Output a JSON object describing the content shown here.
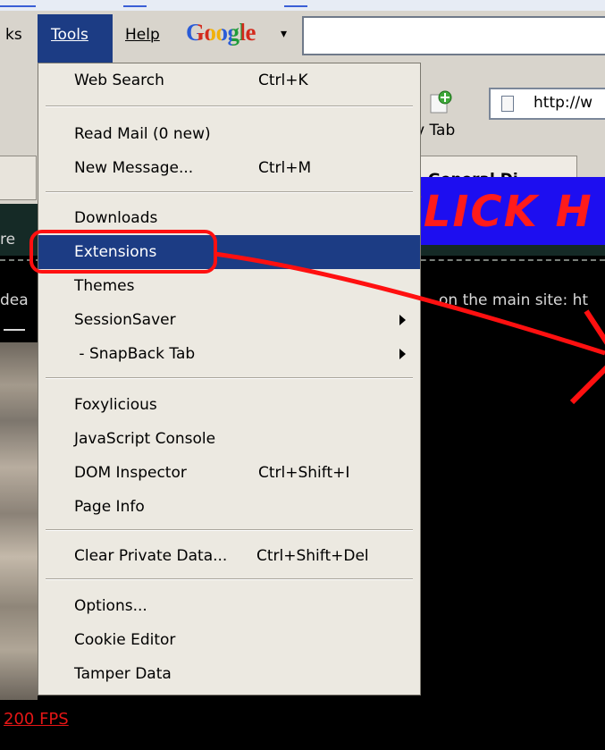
{
  "menubar": {
    "bookmarks_fragment": "ks",
    "tools_label": "Tools",
    "help_label": "Help",
    "google_logo": "Google",
    "google_dropdown_arrow": "▾"
  },
  "toolbar": {
    "new_tab_label": "v Tab",
    "url_text": "http://w"
  },
  "tabs": {
    "general_tab_label": "General Di"
  },
  "page": {
    "fragment_re": "re",
    "fragment_dea": "dea",
    "fragment_main_site": "on the main site: ht",
    "fps_link": "200 FPS"
  },
  "banner": {
    "text": "OMG CLICK H"
  },
  "tools_menu": {
    "items": [
      {
        "label": "Web Search",
        "shortcut": "Ctrl+K"
      },
      {
        "label": "Read Mail (0 new)",
        "shortcut": ""
      },
      {
        "label": "New Message...",
        "shortcut": "Ctrl+M"
      },
      {
        "label": "Downloads",
        "shortcut": ""
      },
      {
        "label": "Extensions",
        "shortcut": "",
        "selected": true
      },
      {
        "label": "Themes",
        "shortcut": ""
      },
      {
        "label": "SessionSaver",
        "shortcut": "",
        "submenu": true
      },
      {
        "label": " - SnapBack Tab",
        "shortcut": "",
        "submenu": true
      },
      {
        "label": "Foxylicious",
        "shortcut": ""
      },
      {
        "label": "JavaScript Console",
        "shortcut": ""
      },
      {
        "label": "DOM Inspector",
        "shortcut": "Ctrl+Shift+I"
      },
      {
        "label": "Page Info",
        "shortcut": ""
      },
      {
        "label": "Clear Private Data...",
        "shortcut": "Ctrl+Shift+Del"
      },
      {
        "label": "Options...",
        "shortcut": ""
      },
      {
        "label": "Cookie Editor",
        "shortcut": ""
      },
      {
        "label": "Tamper Data",
        "shortcut": ""
      }
    ]
  },
  "colors": {
    "menu_highlight": "#1c3c84",
    "annotation_red": "#ff1010",
    "banner_blue": "#1d0ef0"
  }
}
